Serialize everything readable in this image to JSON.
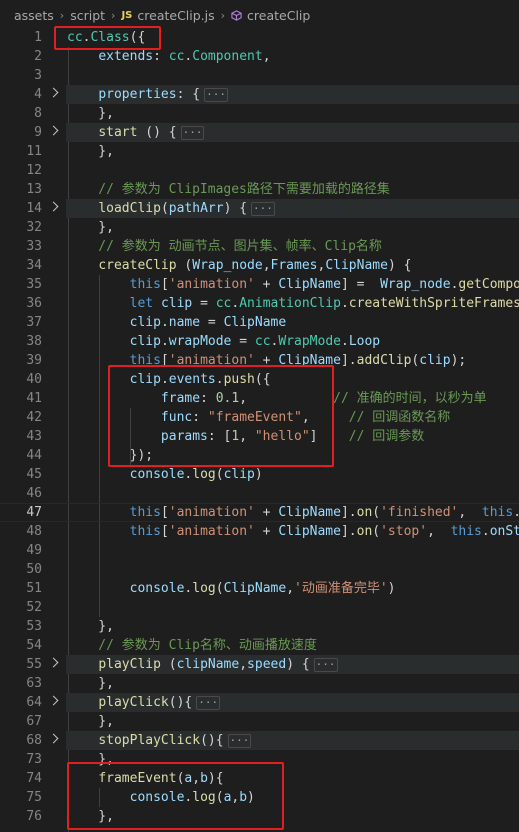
{
  "breadcrumb": {
    "folder1": "assets",
    "folder2": "script",
    "file_badge": "JS",
    "file": "createClip.js",
    "symbol": "createClip"
  },
  "lines": [
    {
      "num": "1",
      "tokens": [
        [
          "t",
          "cc"
        ],
        [
          "p",
          "."
        ],
        [
          "t",
          "Class"
        ],
        [
          "p",
          "({"
        ]
      ]
    },
    {
      "num": "2",
      "tokens": [
        [
          "p",
          "    "
        ],
        [
          "v",
          "extends"
        ],
        [
          "p",
          ": "
        ],
        [
          "t",
          "cc"
        ],
        [
          "p",
          "."
        ],
        [
          "t",
          "Component"
        ],
        [
          "p",
          ","
        ]
      ]
    },
    {
      "num": "3",
      "tokens": []
    },
    {
      "num": "4",
      "fold": true,
      "ellipsis": true,
      "tokens": [
        [
          "p",
          "    "
        ],
        [
          "v",
          "properties"
        ],
        [
          "p",
          ": {"
        ]
      ]
    },
    {
      "num": "8",
      "tokens": [
        [
          "p",
          "    },"
        ]
      ]
    },
    {
      "num": "9",
      "fold": true,
      "ellipsis": true,
      "tokens": [
        [
          "p",
          "    "
        ],
        [
          "f",
          "start"
        ],
        [
          "p",
          " () {"
        ]
      ]
    },
    {
      "num": "11",
      "tokens": [
        [
          "p",
          "    },"
        ]
      ]
    },
    {
      "num": "12",
      "tokens": []
    },
    {
      "num": "13",
      "tokens": [
        [
          "c",
          "    // 参数为 ClipImages路径下需要加载的路径集"
        ]
      ]
    },
    {
      "num": "14",
      "fold": true,
      "ellipsis": true,
      "tokens": [
        [
          "p",
          "    "
        ],
        [
          "f",
          "loadClip"
        ],
        [
          "p",
          "("
        ],
        [
          "v",
          "pathArr"
        ],
        [
          "p",
          ") {"
        ]
      ]
    },
    {
      "num": "32",
      "tokens": [
        [
          "p",
          "    },"
        ]
      ]
    },
    {
      "num": "33",
      "tokens": [
        [
          "c",
          "    // 参数为 动画节点、图片集、帧率、Clip名称"
        ]
      ]
    },
    {
      "num": "34",
      "tokens": [
        [
          "p",
          "    "
        ],
        [
          "f",
          "createClip"
        ],
        [
          "p",
          " ("
        ],
        [
          "v",
          "Wrap_node"
        ],
        [
          "p",
          ","
        ],
        [
          "v",
          "Frames"
        ],
        [
          "p",
          ","
        ],
        [
          "v",
          "ClipName"
        ],
        [
          "p",
          ") {"
        ]
      ]
    },
    {
      "num": "35",
      "tokens": [
        [
          "p",
          "        "
        ],
        [
          "kb",
          "this"
        ],
        [
          "p",
          "["
        ],
        [
          "s",
          "'animation'"
        ],
        [
          "p",
          " + "
        ],
        [
          "v",
          "ClipName"
        ],
        [
          "p",
          "] =  "
        ],
        [
          "v",
          "Wrap_node"
        ],
        [
          "p",
          "."
        ],
        [
          "f",
          "getComponent"
        ]
      ]
    },
    {
      "num": "36",
      "tokens": [
        [
          "p",
          "        "
        ],
        [
          "kb",
          "let"
        ],
        [
          "p",
          " "
        ],
        [
          "v",
          "clip"
        ],
        [
          "p",
          " = "
        ],
        [
          "t",
          "cc"
        ],
        [
          "p",
          "."
        ],
        [
          "t",
          "AnimationClip"
        ],
        [
          "p",
          "."
        ],
        [
          "f",
          "createWithSpriteFrames"
        ],
        [
          "p",
          "("
        ]
      ]
    },
    {
      "num": "37",
      "tokens": [
        [
          "p",
          "        "
        ],
        [
          "v",
          "clip"
        ],
        [
          "p",
          "."
        ],
        [
          "v",
          "name"
        ],
        [
          "p",
          " = "
        ],
        [
          "v",
          "ClipName"
        ]
      ]
    },
    {
      "num": "38",
      "tokens": [
        [
          "p",
          "        "
        ],
        [
          "v",
          "clip"
        ],
        [
          "p",
          "."
        ],
        [
          "v",
          "wrapMode"
        ],
        [
          "p",
          " = "
        ],
        [
          "t",
          "cc"
        ],
        [
          "p",
          "."
        ],
        [
          "t",
          "WrapMode"
        ],
        [
          "p",
          "."
        ],
        [
          "v",
          "Loop"
        ]
      ]
    },
    {
      "num": "39",
      "tokens": [
        [
          "p",
          "        "
        ],
        [
          "kb",
          "this"
        ],
        [
          "p",
          "["
        ],
        [
          "s",
          "'animation'"
        ],
        [
          "p",
          " + "
        ],
        [
          "v",
          "ClipName"
        ],
        [
          "p",
          "]."
        ],
        [
          "f",
          "addClip"
        ],
        [
          "p",
          "("
        ],
        [
          "v",
          "clip"
        ],
        [
          "p",
          ");"
        ]
      ]
    },
    {
      "num": "40",
      "tokens": [
        [
          "p",
          "        "
        ],
        [
          "v",
          "clip"
        ],
        [
          "p",
          "."
        ],
        [
          "v",
          "events"
        ],
        [
          "p",
          "."
        ],
        [
          "f",
          "push"
        ],
        [
          "p",
          "({"
        ]
      ]
    },
    {
      "num": "41",
      "tokens": [
        [
          "p",
          "            "
        ],
        [
          "v",
          "frame"
        ],
        [
          "p",
          ": "
        ],
        [
          "n",
          "0.1"
        ],
        [
          "p",
          ",           "
        ],
        [
          "c",
          "// 准确的时间，以秒为单"
        ]
      ]
    },
    {
      "num": "42",
      "tokens": [
        [
          "p",
          "            "
        ],
        [
          "v",
          "func"
        ],
        [
          "p",
          ": "
        ],
        [
          "s",
          "\"frameEvent\""
        ],
        [
          "p",
          ",     "
        ],
        [
          "c",
          "// 回调函数名称"
        ]
      ]
    },
    {
      "num": "43",
      "tokens": [
        [
          "p",
          "            "
        ],
        [
          "v",
          "params"
        ],
        [
          "p",
          ": ["
        ],
        [
          "n",
          "1"
        ],
        [
          "p",
          ", "
        ],
        [
          "s",
          "\"hello\""
        ],
        [
          "p",
          "]    "
        ],
        [
          "c",
          "// 回调参数"
        ]
      ]
    },
    {
      "num": "44",
      "tokens": [
        [
          "p",
          "        });"
        ]
      ]
    },
    {
      "num": "45",
      "tokens": [
        [
          "p",
          "        "
        ],
        [
          "v",
          "console"
        ],
        [
          "p",
          "."
        ],
        [
          "f",
          "log"
        ],
        [
          "p",
          "("
        ],
        [
          "v",
          "clip"
        ],
        [
          "p",
          ")"
        ]
      ]
    },
    {
      "num": "46",
      "tokens": []
    },
    {
      "num": "47",
      "active": true,
      "tokens": [
        [
          "p",
          "        "
        ],
        [
          "kb",
          "this"
        ],
        [
          "p",
          "["
        ],
        [
          "s",
          "'animation'"
        ],
        [
          "p",
          " + "
        ],
        [
          "v",
          "ClipName"
        ],
        [
          "p",
          "]."
        ],
        [
          "f",
          "on"
        ],
        [
          "p",
          "("
        ],
        [
          "s",
          "'finished'"
        ],
        [
          "p",
          ",  "
        ],
        [
          "kb",
          "this"
        ],
        [
          "p",
          "."
        ],
        [
          "v",
          "on"
        ]
      ]
    },
    {
      "num": "48",
      "tokens": [
        [
          "p",
          "        "
        ],
        [
          "kb",
          "this"
        ],
        [
          "p",
          "["
        ],
        [
          "s",
          "'animation'"
        ],
        [
          "p",
          " + "
        ],
        [
          "v",
          "ClipName"
        ],
        [
          "p",
          "]."
        ],
        [
          "f",
          "on"
        ],
        [
          "p",
          "("
        ],
        [
          "s",
          "'stop'"
        ],
        [
          "p",
          ",  "
        ],
        [
          "kb",
          "this"
        ],
        [
          "p",
          "."
        ],
        [
          "v",
          "onSto"
        ]
      ]
    },
    {
      "num": "49",
      "tokens": []
    },
    {
      "num": "50",
      "tokens": []
    },
    {
      "num": "51",
      "tokens": [
        [
          "p",
          "        "
        ],
        [
          "v",
          "console"
        ],
        [
          "p",
          "."
        ],
        [
          "f",
          "log"
        ],
        [
          "p",
          "("
        ],
        [
          "v",
          "ClipName"
        ],
        [
          "p",
          ","
        ],
        [
          "s",
          "'动画准备完毕'"
        ],
        [
          "p",
          ")"
        ]
      ]
    },
    {
      "num": "52",
      "tokens": []
    },
    {
      "num": "53",
      "tokens": [
        [
          "p",
          "    },"
        ]
      ]
    },
    {
      "num": "54",
      "tokens": [
        [
          "c",
          "    // 参数为 Clip名称、动画播放速度"
        ]
      ]
    },
    {
      "num": "55",
      "fold": true,
      "ellipsis": true,
      "tokens": [
        [
          "p",
          "    "
        ],
        [
          "f",
          "playClip"
        ],
        [
          "p",
          " ("
        ],
        [
          "v",
          "clipName"
        ],
        [
          "p",
          ","
        ],
        [
          "v",
          "speed"
        ],
        [
          "p",
          ") {"
        ]
      ]
    },
    {
      "num": "63",
      "tokens": [
        [
          "p",
          "    },"
        ]
      ]
    },
    {
      "num": "64",
      "fold": true,
      "ellipsis": true,
      "tokens": [
        [
          "p",
          "    "
        ],
        [
          "f",
          "playClick"
        ],
        [
          "p",
          "(){"
        ]
      ]
    },
    {
      "num": "67",
      "tokens": [
        [
          "p",
          "    },"
        ]
      ]
    },
    {
      "num": "68",
      "fold": true,
      "ellipsis": true,
      "tokens": [
        [
          "p",
          "    "
        ],
        [
          "f",
          "stopPlayClick"
        ],
        [
          "p",
          "(){"
        ]
      ]
    },
    {
      "num": "73",
      "tokens": [
        [
          "p",
          "    },"
        ]
      ]
    },
    {
      "num": "74",
      "tokens": [
        [
          "p",
          "    "
        ],
        [
          "f",
          "frameEvent"
        ],
        [
          "p",
          "("
        ],
        [
          "v",
          "a"
        ],
        [
          "p",
          ","
        ],
        [
          "v",
          "b"
        ],
        [
          "p",
          "){"
        ]
      ]
    },
    {
      "num": "75",
      "tokens": [
        [
          "p",
          "        "
        ],
        [
          "v",
          "console"
        ],
        [
          "p",
          "."
        ],
        [
          "f",
          "log"
        ],
        [
          "p",
          "("
        ],
        [
          "v",
          "a"
        ],
        [
          "p",
          ","
        ],
        [
          "v",
          "b"
        ],
        [
          "p",
          ")"
        ]
      ]
    },
    {
      "num": "76",
      "tokens": [
        [
          "p",
          "    },"
        ]
      ]
    }
  ],
  "ellipsis_glyph": "···"
}
